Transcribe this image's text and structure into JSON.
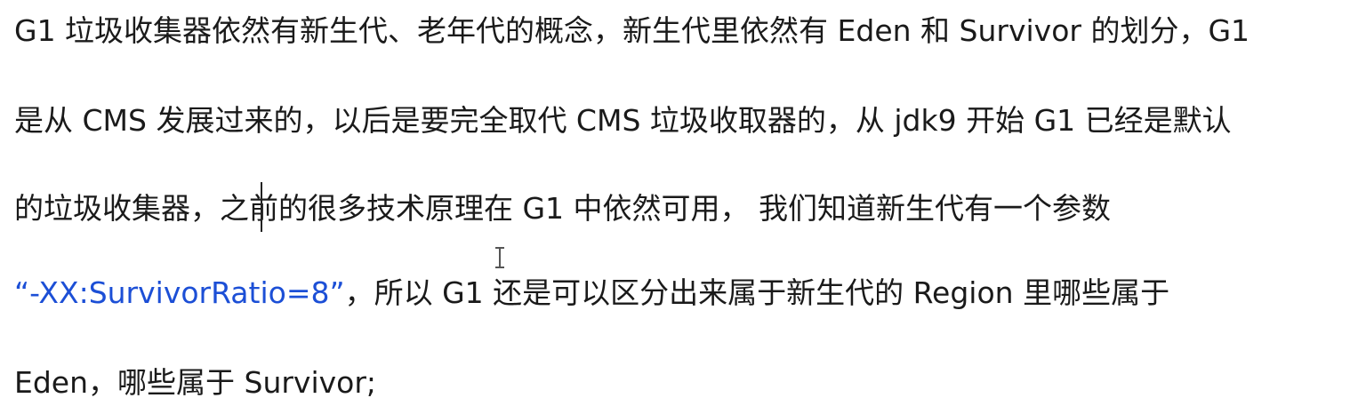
{
  "document": {
    "lines": [
      "G1 垃圾收集器依然有新生代、老年代的概念，新生代里依然有 Eden 和 Survivor 的划分，G1",
      "是从 CMS 发展过来的，以后是要完全取代 CMS 垃圾收取器的，从 jdk9 开始 G1 已经是默认",
      "的垃圾收集器，之前的很多技术原理在 G1 中依然可用，  我们知道新生代有一个参数",
      {
        "parameter": "“-XX:SurvivorRatio=8”",
        "rest": "，所以 G1 还是可以区分出来属于新生代的 Region 里哪些属于"
      },
      "Eden，哪些属于 Survivor;"
    ]
  },
  "colors": {
    "text": "#1a1a1a",
    "parameter": "#1c4fd6",
    "background": "#ffffff"
  },
  "cursor": {
    "text_caret": "text-caret",
    "mouse_pointer": "i-beam-cursor-icon"
  }
}
